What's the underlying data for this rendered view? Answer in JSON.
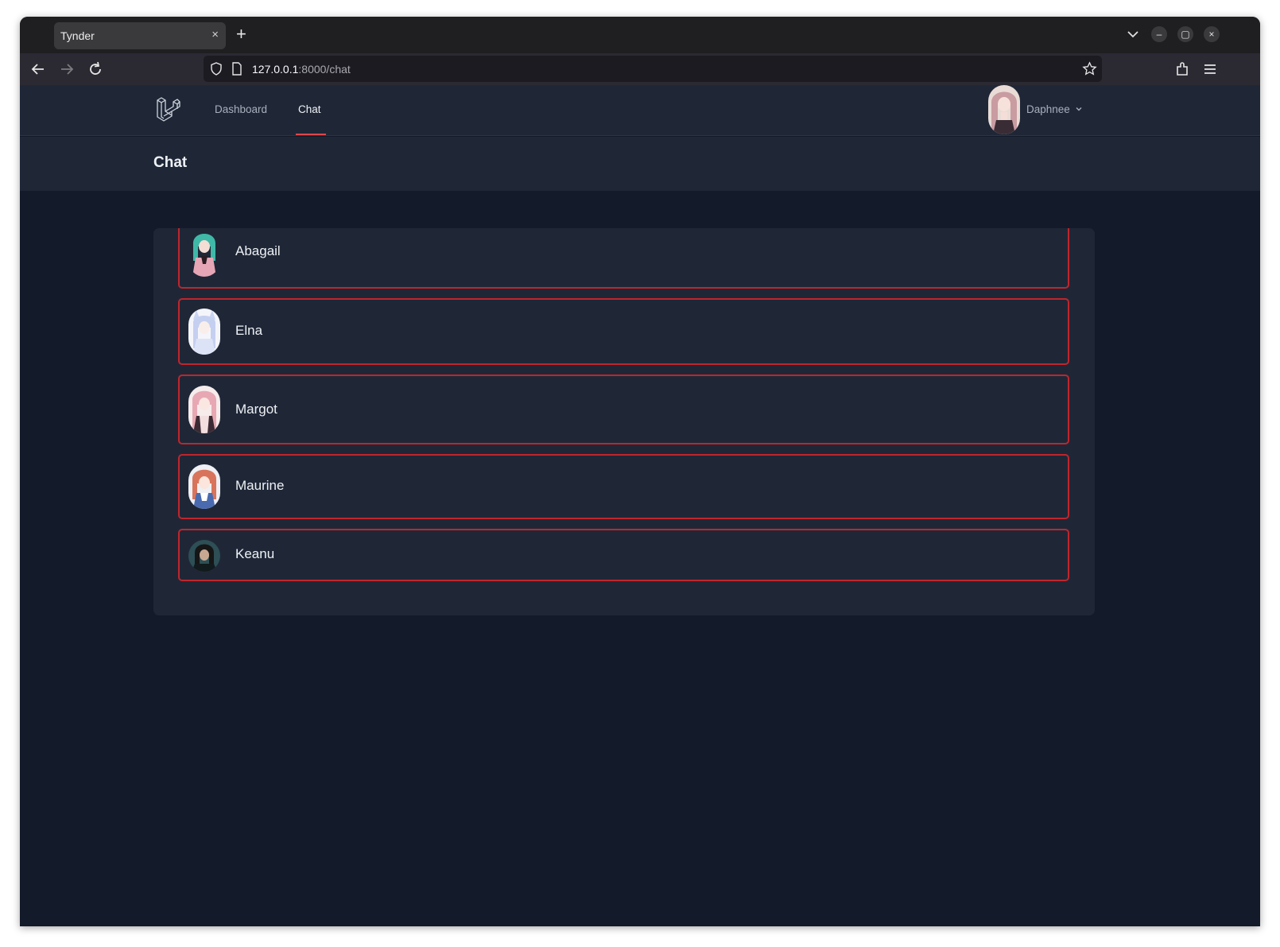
{
  "browser": {
    "tab_title": "Tynder",
    "tab_close": "×",
    "new_tab": "+",
    "url_host": "127.0.0.1",
    "url_rest": ":8000/chat",
    "window_buttons": [
      "–",
      "▢",
      "×"
    ]
  },
  "app": {
    "nav": {
      "links": [
        {
          "label": "Dashboard",
          "active": false
        },
        {
          "label": "Chat",
          "active": true
        }
      ],
      "user": {
        "name": "Daphnee"
      }
    },
    "page_title": "Chat",
    "chats": [
      {
        "name": "Abagail"
      },
      {
        "name": "Elna"
      },
      {
        "name": "Margot"
      },
      {
        "name": "Maurine"
      },
      {
        "name": "Keanu"
      }
    ]
  },
  "colors": {
    "accent": "#e0474c",
    "row_border": "#c0252c",
    "page_bg": "#131a29",
    "panel_bg": "#1f2737"
  }
}
